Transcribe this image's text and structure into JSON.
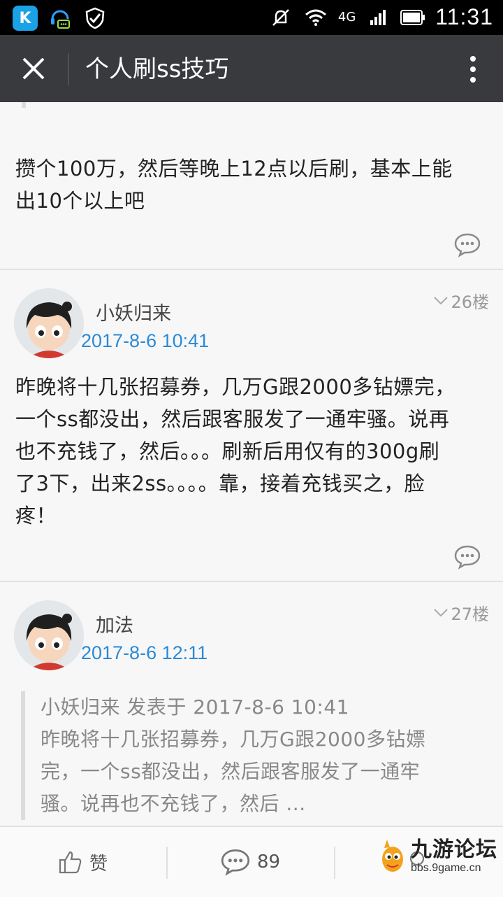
{
  "status_bar": {
    "app_icon_letter": "K",
    "network": "4G",
    "time": "11:31"
  },
  "title_bar": {
    "title": "个人刷ss技巧"
  },
  "posts": [
    {
      "body_lines": [
        "攒个100万，然后等晚上12点以后刷，基本上能",
        "出10个以上吧"
      ]
    },
    {
      "username": "小妖归来",
      "time": "2017-8-6 10:41",
      "floor": "26楼",
      "body_lines": [
        "昨晚将十几张招募券，几万G跟2000多钻嫖完，",
        "一个ss都没出，然后跟客服发了一通牢骚。说再",
        "也不充钱了，然后。。。刷新后用仅有的300g刷",
        "了3下，出来2ss。。。。靠，接着充钱买之，脸",
        "疼！"
      ]
    },
    {
      "username": "加法",
      "time": "2017-8-6 12:11",
      "floor": "27楼",
      "quote": {
        "header": "小妖归来 发表于 2017-8-6 10:41",
        "lines": [
          "昨晚将十几张招募券，几万G跟2000多钻嫖",
          "完，一个ss都没出，然后跟客服发了一通牢",
          "骚。说再也不充钱了，然后 ..."
        ]
      }
    }
  ],
  "bottom_bar": {
    "like_label": "赞",
    "comment_count": "89"
  },
  "watermark": {
    "main": "九游论坛",
    "sub": "bbs.9game.cn"
  },
  "colors": {
    "accent_blue": "#2b8ad6",
    "title_bar_bg": "#393a3e"
  }
}
